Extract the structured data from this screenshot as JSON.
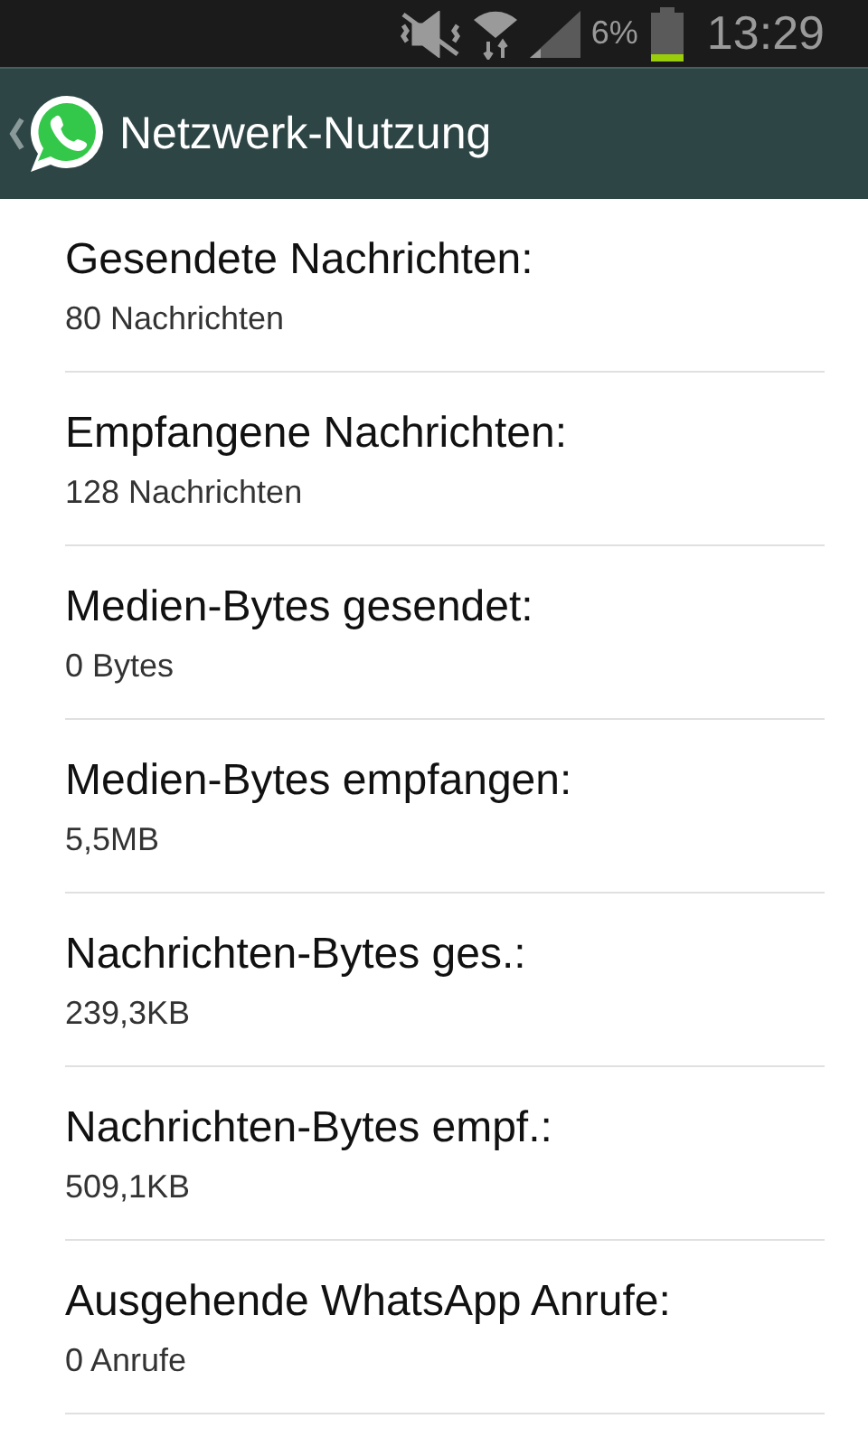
{
  "status_bar": {
    "battery_text": "6%",
    "time": "13:29"
  },
  "action_bar": {
    "title": "Netzwerk-Nutzung"
  },
  "items": [
    {
      "title": "Gesendete Nachrichten:",
      "value": "80 Nachrichten"
    },
    {
      "title": "Empfangene Nachrichten:",
      "value": "128 Nachrichten"
    },
    {
      "title": "Medien-Bytes gesendet:",
      "value": "0 Bytes"
    },
    {
      "title": "Medien-Bytes empfangen:",
      "value": "5,5MB"
    },
    {
      "title": "Nachrichten-Bytes ges.:",
      "value": "239,3KB"
    },
    {
      "title": "Nachrichten-Bytes empf.:",
      "value": "509,1KB"
    },
    {
      "title": "Ausgehende WhatsApp Anrufe:",
      "value": "0 Anrufe"
    }
  ]
}
